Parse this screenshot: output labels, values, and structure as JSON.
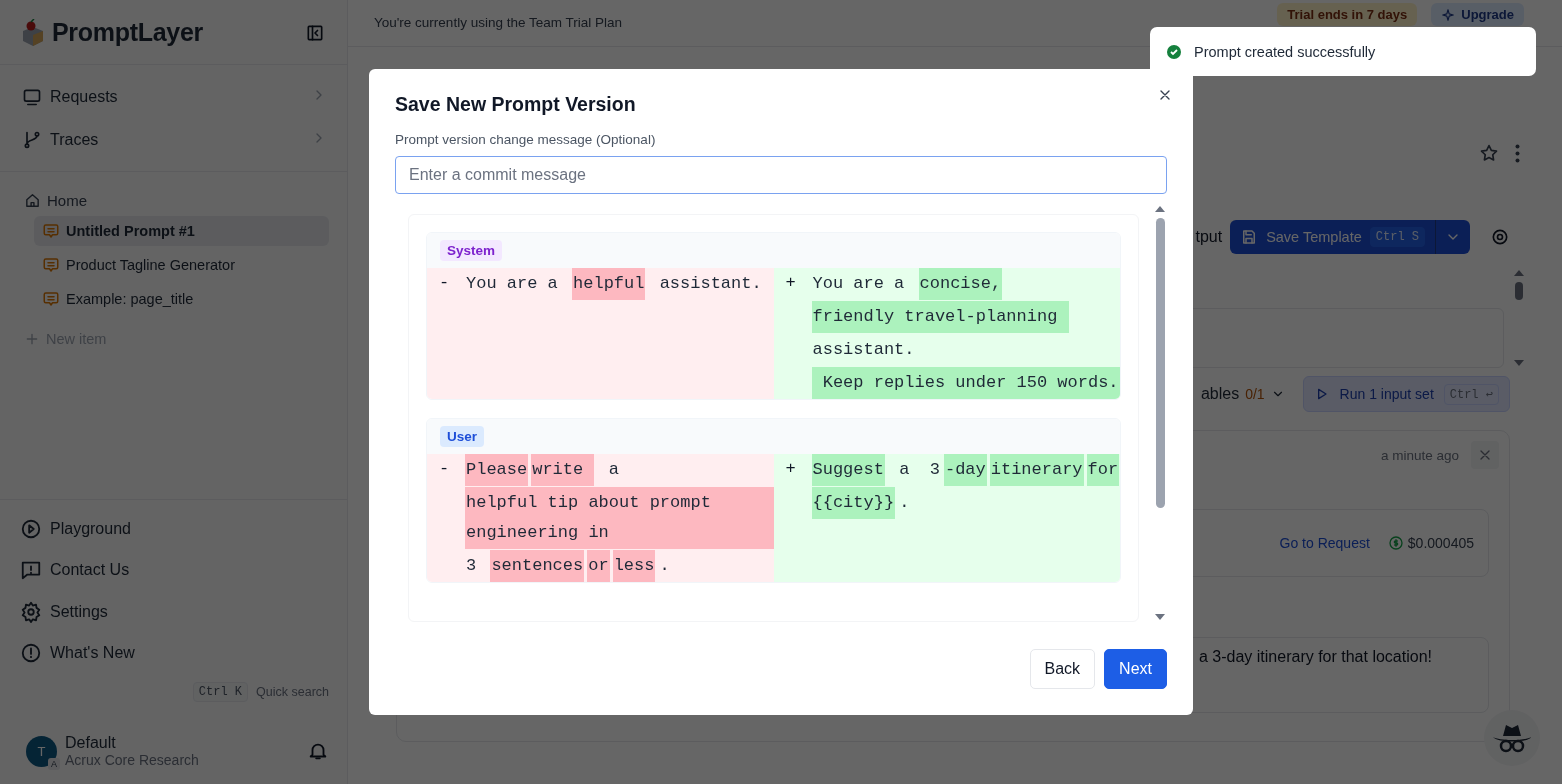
{
  "sidebar": {
    "logo": "PromptLayer",
    "nav": [
      {
        "label": "Requests"
      },
      {
        "label": "Traces"
      }
    ],
    "tree": {
      "label": "Home",
      "children": [
        {
          "label": "Untitled Prompt #1",
          "selected": true
        },
        {
          "label": "Product Tagline Generator",
          "selected": false
        },
        {
          "label": "Example: page_title",
          "selected": false
        }
      ]
    },
    "new_item": "New item",
    "bottom_nav": [
      {
        "label": "Playground"
      },
      {
        "label": "Contact Us"
      },
      {
        "label": "Settings"
      },
      {
        "label": "What's New"
      }
    ],
    "shortcut": {
      "keys": "Ctrl K",
      "label": "Quick search"
    },
    "workspace": {
      "avatar": "T",
      "avatar_badge": "A",
      "name": "Default",
      "org": "Acrux Core Research"
    }
  },
  "topbar": {
    "plan": "You're currently using the Team Trial Plan",
    "trial": "Trial ends in 7 days",
    "upgrade": "Upgrade"
  },
  "editor": {
    "tab_partial": "tput",
    "save": {
      "label": "Save Template",
      "shortcut": "Ctrl S"
    },
    "variables": {
      "label": "ables",
      "count": "0/1"
    },
    "run": {
      "label": "Run 1 input set",
      "shortcut": "Ctrl ↩"
    },
    "result": {
      "time": "a minute ago",
      "link": "Go to Request",
      "cost": "$0.000405",
      "message": "a 3-day itinerary for that location!"
    }
  },
  "modal": {
    "title": "Save New Prompt Version",
    "field_label": "Prompt version change message (Optional)",
    "placeholder": "Enter a commit message",
    "diffs": [
      {
        "role": "System",
        "kind": "system",
        "removed": [
          [
            {
              "text": "You are a ",
              "changed": false
            },
            {
              "text": "helpful",
              "changed": true
            },
            {
              "text": " assistant.",
              "changed": false
            }
          ]
        ],
        "added": [
          [
            {
              "text": "You are a ",
              "changed": false
            },
            {
              "text": "concise,",
              "changed": true
            }
          ],
          [
            {
              "text": "friendly travel-planning ",
              "changed": true
            }
          ],
          [
            {
              "text": "assistant.",
              "changed": false
            }
          ],
          [
            {
              "text": " Keep replies under 150 words.",
              "changed": true
            }
          ]
        ]
      },
      {
        "role": "User",
        "kind": "user",
        "removed": [
          [
            {
              "text": "Please",
              "changed": true
            },
            {
              "text": "write ",
              "changed": true
            },
            {
              "text": " a",
              "changed": false
            }
          ],
          [
            {
              "text": "helpful tip about prompt engineering in",
              "changed": true
            }
          ],
          [
            {
              "text": "3 ",
              "changed": false
            },
            {
              "text": "sentences",
              "changed": true
            },
            {
              "text": "or",
              "changed": true
            },
            {
              "text": "less",
              "changed": true
            },
            {
              "text": ".",
              "changed": false
            }
          ]
        ],
        "added": [
          [
            {
              "text": "Suggest",
              "changed": true
            },
            {
              "text": " a  3",
              "changed": false
            },
            {
              "text": "-day",
              "changed": true
            },
            {
              "text": "itinerary",
              "changed": true
            },
            {
              "text": "for",
              "changed": true
            }
          ],
          [
            {
              "text": "{{city}}",
              "changed": true
            },
            {
              "text": ".",
              "changed": false
            }
          ]
        ]
      }
    ],
    "removed_mark": "-",
    "added_mark": "+",
    "buttons": [
      {
        "label": "Back",
        "kind": "secondary"
      },
      {
        "label": "Next",
        "kind": "primary"
      }
    ]
  },
  "toast": {
    "message": "Prompt created successfully"
  }
}
